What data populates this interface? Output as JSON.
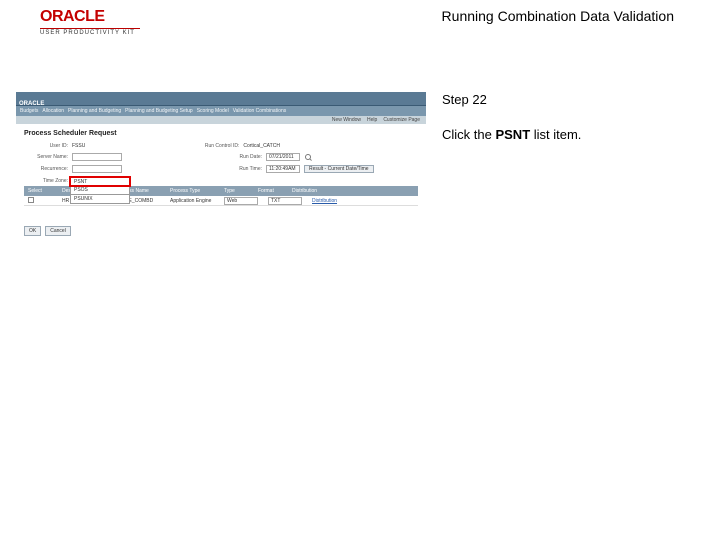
{
  "header": {
    "logo": "ORACLE",
    "upk": "USER PRODUCTIVITY KIT",
    "title": "Running Combination Data Validation"
  },
  "screenshot": {
    "nav": [
      "Budgets",
      "Allocation",
      "Planning and Budgeting",
      "Planning and Budgeting Setup",
      "Scoring Model",
      "Validation Combinations"
    ],
    "subhead": {
      "new": "New Window",
      "help": "Help",
      "customize": "Customize Page"
    },
    "reqTitle": "Process Scheduler Request",
    "userLabel": "User ID:",
    "userVal": "FSSU",
    "rcLabel": "Run Control ID:",
    "rcVal": "Cortical_CATCH",
    "srvLabel": "Server Name:",
    "rdLabel": "Run Date:",
    "rdVal": "07/21/2011",
    "recLabel": "Recurrence:",
    "rtLabel": "Run Time:",
    "rtVal": "11:20:49AM",
    "resetBtn": "Result - Current Date/Time",
    "tzLabel": "Time Zone:",
    "ddItems": [
      "PSNT",
      "PSOS",
      "PSUNIX"
    ],
    "cols": {
      "sel": "Select",
      "desc": "Description",
      "proc": "Process Name",
      "type": "Process Type",
      "typeh": "Type",
      "fmt": "Format",
      "dist": "Distribution"
    },
    "row": {
      "sel": "P",
      "desc": "HR Combination Validation",
      "proc": "FS_EE_COMBD",
      "type": "Application Engine",
      "typeVal": "Web",
      "fmtVal": "TXT",
      "dist": "Distribution"
    },
    "btnOk": "OK",
    "btnCancel": "Cancel"
  },
  "instructions": {
    "step": "Step 22",
    "pre": "Click the ",
    "bold": "PSNT",
    "post": " list item."
  }
}
